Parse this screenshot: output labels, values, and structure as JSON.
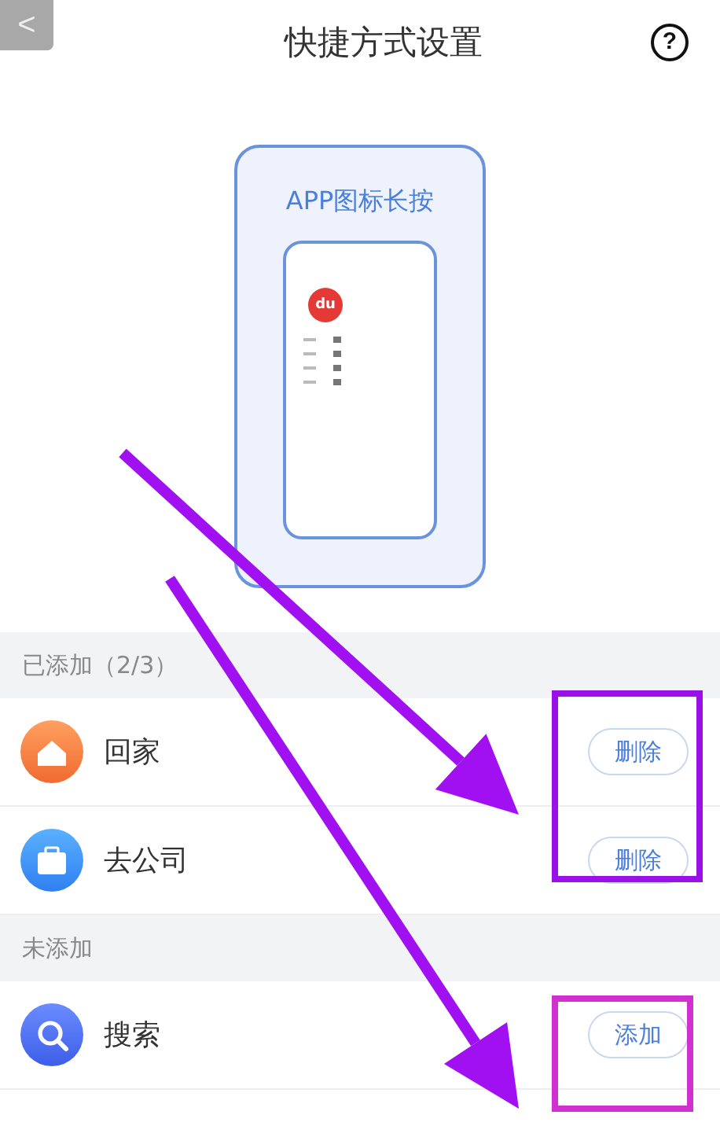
{
  "header": {
    "back": "<",
    "title": "快捷方式设置",
    "help": "?"
  },
  "guide": {
    "caption": "APP图标长按",
    "logo": "du"
  },
  "sections": [
    {
      "title": "已添加（2/3）",
      "items": [
        {
          "name": "回家",
          "kind": "home",
          "action": "删除"
        },
        {
          "name": "去公司",
          "kind": "work",
          "action": "删除"
        }
      ]
    },
    {
      "title": "未添加",
      "items": [
        {
          "name": "搜索",
          "kind": "search",
          "action": "添加"
        }
      ]
    }
  ],
  "annotations": [
    {
      "kind": "arrow",
      "color": "#a010f0"
    },
    {
      "kind": "arrow",
      "color": "#a010f0"
    },
    {
      "kind": "frame",
      "color": "#9a10e8"
    },
    {
      "kind": "frame",
      "color": "#d030d0"
    }
  ]
}
